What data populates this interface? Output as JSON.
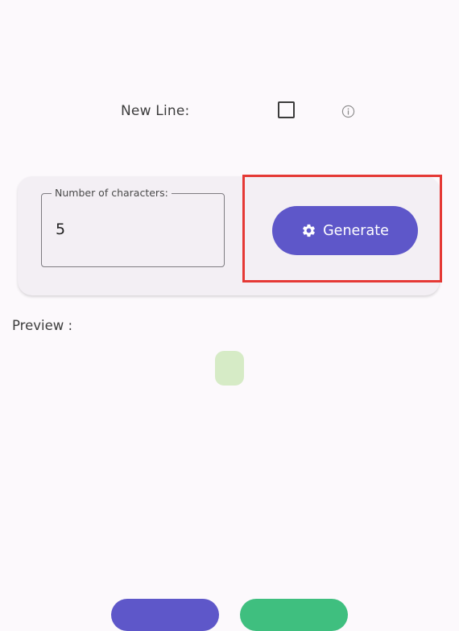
{
  "options": {
    "new_line_label": "New Line:",
    "new_line_checked": false,
    "info_icon": "info-icon"
  },
  "generator": {
    "chars_label": "Number of characters:",
    "chars_value": "5",
    "generate_label": "Generate",
    "generate_icon": "gear-icon"
  },
  "preview": {
    "label": "Preview :",
    "content": ""
  },
  "colors": {
    "primary": "#5e57c9",
    "highlight": "#e53935",
    "preview_chip": "#d6ebc6",
    "secondary": "#3fbf7f"
  }
}
